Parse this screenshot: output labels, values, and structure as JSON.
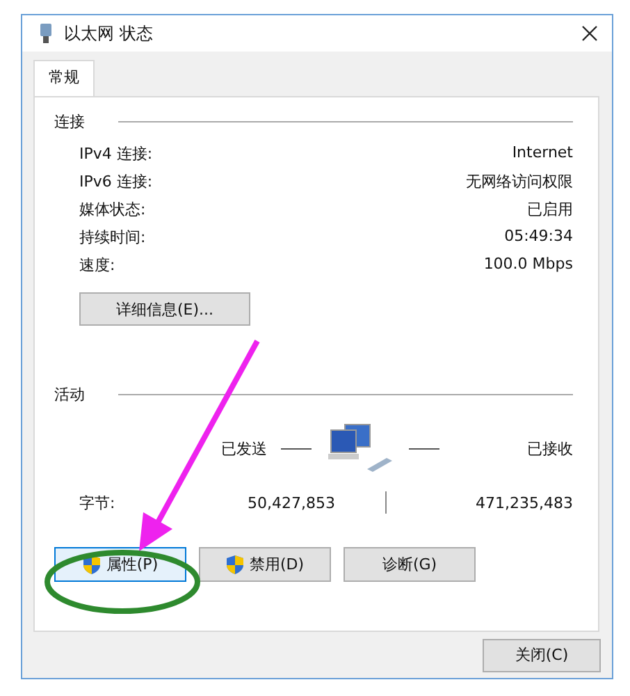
{
  "window": {
    "title": "以太网 状态"
  },
  "tabs": [
    {
      "label": "常规",
      "selected": true
    }
  ],
  "connection": {
    "heading": "连接",
    "rows": [
      {
        "label": "IPv4 连接:",
        "value": "Internet"
      },
      {
        "label": "IPv6 连接:",
        "value": "无网络访问权限"
      },
      {
        "label": "媒体状态:",
        "value": "已启用"
      },
      {
        "label": "持续时间:",
        "value": "05:49:34"
      },
      {
        "label": "速度:",
        "value": "100.0 Mbps"
      }
    ],
    "details_button": "详细信息(E)..."
  },
  "activity": {
    "heading": "活动",
    "sent_label": "已发送",
    "received_label": "已接收",
    "bytes_label": "字节:",
    "bytes_sent": "50,427,853",
    "bytes_received": "471,235,483"
  },
  "buttons": [
    {
      "label": "属性(P)",
      "kind": "shield",
      "focused": true
    },
    {
      "label": "禁用(D)",
      "kind": "shield",
      "focused": false
    },
    {
      "label": "诊断(G)",
      "kind": "plain",
      "focused": false
    }
  ],
  "close_button": "关闭(C)"
}
